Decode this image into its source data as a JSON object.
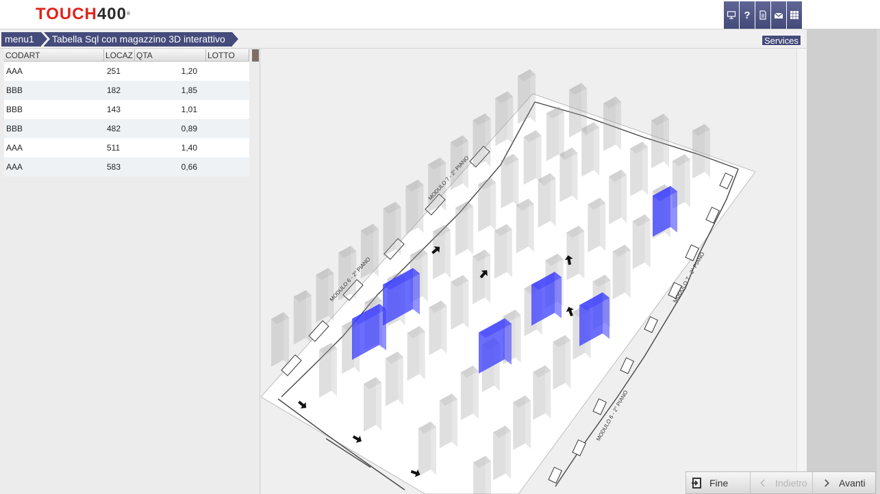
{
  "app": {
    "logo_red": "TOUCH",
    "logo_dark": "400",
    "logo_mark": "®"
  },
  "toolbar": {
    "icons": [
      "monitor-icon",
      "help-icon",
      "document-icon",
      "mail-icon",
      "grid-icon"
    ],
    "help_glyph": "?"
  },
  "breadcrumb": {
    "items": [
      "menu1",
      "Tabella Sql  con magazzino 3D interattivo"
    ]
  },
  "services": {
    "label": "Services"
  },
  "table": {
    "columns": [
      "CODART",
      "LOCAZ",
      "QTA",
      "LOTTO"
    ],
    "rows": [
      {
        "codart": "AAA",
        "locaz": "251",
        "qta": "1,20",
        "lotto": ""
      },
      {
        "codart": "BBB",
        "locaz": "182",
        "qta": "1,85",
        "lotto": ""
      },
      {
        "codart": "BBB",
        "locaz": "143",
        "qta": "1,01",
        "lotto": ""
      },
      {
        "codart": "BBB",
        "locaz": "482",
        "qta": "0,89",
        "lotto": ""
      },
      {
        "codart": "AAA",
        "locaz": "511",
        "qta": "1,40",
        "lotto": ""
      },
      {
        "codart": "AAA",
        "locaz": "583",
        "qta": "0,66",
        "lotto": ""
      }
    ]
  },
  "warehouse": {
    "labels": [
      "MODULO 6 - 2° PIANO",
      "MODULO 7 - 2° PIANO",
      "MODULO 7 - 2° PIANO",
      "MODULO 6 - 2° PIANO"
    ],
    "highlight_color": "#3a3cff",
    "rack_color": "#9a9a9a"
  },
  "nav": {
    "fine": "Fine",
    "back": "Indietro",
    "next": "Avanti"
  }
}
